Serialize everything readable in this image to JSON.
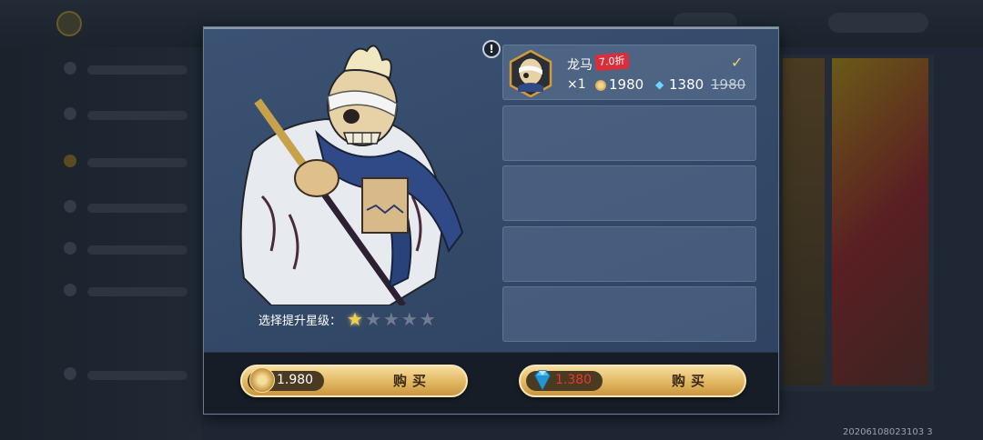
{
  "modal": {
    "info_icon": "!",
    "star_selector": {
      "label": "选择提升星级：",
      "stars": [
        "★",
        "★",
        "★",
        "★",
        "★"
      ],
      "selected": 1
    },
    "items": [
      {
        "name": "龙马",
        "discount": "7.0折",
        "check": "✓",
        "qty": "×1",
        "coin_price": "1980",
        "gem_price": "1380",
        "original_price": "1980"
      }
    ],
    "buy_coin": {
      "amount": "1.980",
      "label": "购买"
    },
    "buy_gem": {
      "amount": "1.380",
      "label": "购买"
    }
  },
  "timestamp": "20206108023103 3"
}
